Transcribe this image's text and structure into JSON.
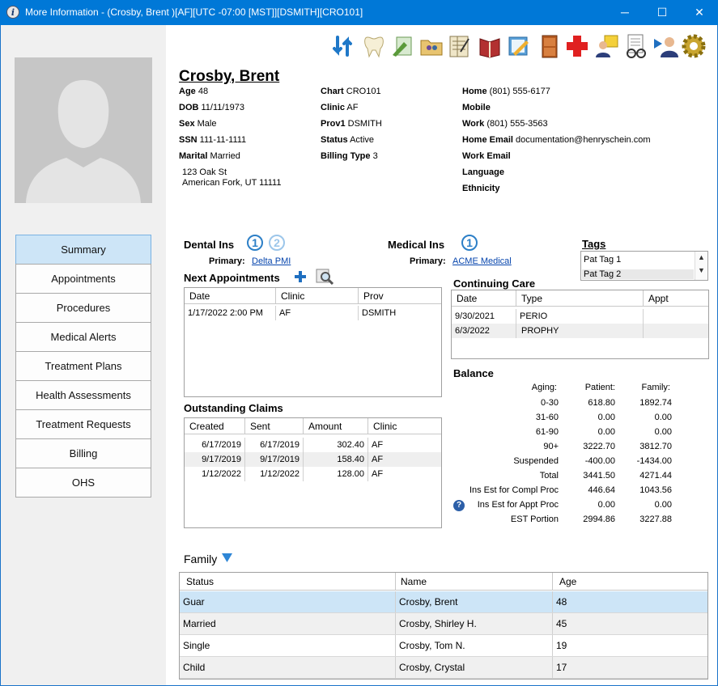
{
  "window": {
    "title": "More Information - (Crosby, Brent )[AF][UTC -07:00 [MST]][DSMITH][CRO101]",
    "minimize": "─",
    "maximize": "☐",
    "close": "✕"
  },
  "nav": {
    "items": [
      "Summary",
      "Appointments",
      "Procedures",
      "Medical Alerts",
      "Treatment Plans",
      "Health Assessments",
      "Treatment Requests",
      "Billing",
      "OHS"
    ],
    "active": "Summary"
  },
  "toolbar": {
    "icons": [
      "refresh-icon",
      "tooth-icon",
      "edit-form-icon",
      "folder-people-icon",
      "ledger-icon",
      "book-icon",
      "notebook-pencil-icon",
      "cabinet-icon",
      "medical-cross-icon",
      "person-note-icon",
      "glasses-doc-icon",
      "play-person-icon",
      "gear-icon"
    ]
  },
  "patient": {
    "name": "Crosby, Brent",
    "col1": [
      {
        "label": "Age",
        "value": "48"
      },
      {
        "label": "DOB",
        "value": "11/11/1973"
      },
      {
        "label": "Sex",
        "value": "Male"
      },
      {
        "label": "SSN",
        "value": "111-11-1111"
      },
      {
        "label": "Marital",
        "value": "Married"
      }
    ],
    "address1": "123 Oak St",
    "address2": "American Fork,  UT 11111",
    "col2": [
      {
        "label": "Chart",
        "value": "CRO101"
      },
      {
        "label": "Clinic",
        "value": "AF"
      },
      {
        "label": "Prov1",
        "value": "DSMITH"
      },
      {
        "label": "Status",
        "value": "Active"
      },
      {
        "label": "Billing Type",
        "value": "3"
      }
    ],
    "col3": [
      {
        "label": "Home",
        "value": "(801) 555-6177"
      },
      {
        "label": "Mobile",
        "value": ""
      },
      {
        "label": "Work",
        "value": "(801) 555-3563"
      },
      {
        "label": "Home Email",
        "value": "documentation@henryschein.com"
      },
      {
        "label": "Work Email",
        "value": ""
      },
      {
        "label": "Language",
        "value": ""
      },
      {
        "label": "Ethnicity",
        "value": ""
      }
    ]
  },
  "dental_ins": {
    "title": "Dental Ins",
    "circle1": "1",
    "circle2": "2",
    "primary_label": "Primary:",
    "primary_value": "Delta PMI"
  },
  "medical_ins": {
    "title": "Medical Ins",
    "circle1": "1",
    "primary_label": "Primary:",
    "primary_value": "ACME Medical"
  },
  "tags": {
    "title": "Tags",
    "items": [
      "Pat Tag 1",
      "Pat Tag 2"
    ]
  },
  "next_appointments": {
    "title": "Next Appointments",
    "columns": [
      "Date",
      "Clinic",
      "Prov"
    ],
    "rows": [
      [
        "1/17/2022 2:00 PM",
        "AF",
        "DSMITH"
      ]
    ]
  },
  "continuing_care": {
    "title": "Continuing Care",
    "columns": [
      "Date",
      "Type",
      "Appt"
    ],
    "rows": [
      [
        "9/30/2021",
        "PERIO",
        ""
      ],
      [
        "6/3/2022",
        "PROPHY",
        ""
      ]
    ]
  },
  "outstanding_claims": {
    "title": "Outstanding Claims",
    "columns": [
      "Created",
      "Sent",
      "Amount",
      "Clinic"
    ],
    "rows": [
      [
        "6/17/2019",
        "6/17/2019",
        "302.40",
        "AF"
      ],
      [
        "9/17/2019",
        "9/17/2019",
        "158.40",
        "AF"
      ],
      [
        "1/12/2022",
        "1/12/2022",
        "128.00",
        "AF"
      ]
    ]
  },
  "balance": {
    "title": "Balance",
    "headers": [
      "Aging:",
      "Patient:",
      "Family:"
    ],
    "rows": [
      [
        "0-30",
        "618.80",
        "1892.74"
      ],
      [
        "31-60",
        "0.00",
        "0.00"
      ],
      [
        "61-90",
        "0.00",
        "0.00"
      ],
      [
        "90+",
        "3222.70",
        "3812.70"
      ],
      [
        "Suspended",
        "-400.00",
        "-1434.00"
      ],
      [
        "Total",
        "3441.50",
        "4271.44"
      ],
      [
        "Ins Est for Compl Proc",
        "446.64",
        "1043.56"
      ],
      [
        "Ins Est for Appt Proc",
        "0.00",
        "0.00"
      ],
      [
        "EST Portion",
        "2994.86",
        "3227.88"
      ]
    ]
  },
  "family": {
    "title": "Family",
    "columns": [
      "Status",
      "Name",
      "Age"
    ],
    "rows": [
      [
        "Guar",
        "Crosby, Brent",
        "48"
      ],
      [
        "Married",
        "Crosby, Shirley H.",
        "45"
      ],
      [
        "Single",
        "Crosby, Tom N.",
        "19"
      ],
      [
        "Child",
        "Crosby, Crystal",
        "17"
      ]
    ]
  }
}
